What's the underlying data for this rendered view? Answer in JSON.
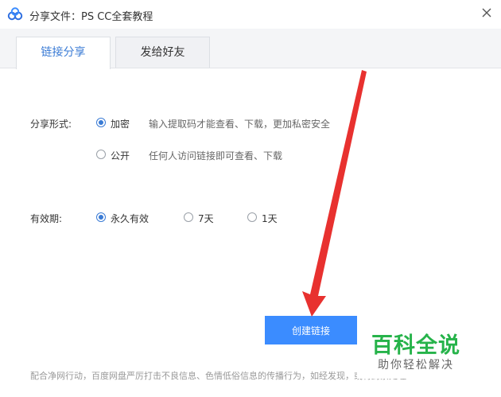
{
  "window": {
    "title": "分享文件：PS CC全套教程",
    "close_icon": "close-icon"
  },
  "tabs": [
    {
      "label": "链接分享",
      "active": true
    },
    {
      "label": "发给好友",
      "active": false
    }
  ],
  "share_form": {
    "label": "分享形式:",
    "options": [
      {
        "label": "加密",
        "desc": "输入提取码才能查看、下载，更加私密安全",
        "checked": true
      },
      {
        "label": "公开",
        "desc": "任何人访问链接即可查看、下载",
        "checked": false
      }
    ]
  },
  "validity": {
    "label": "有效期:",
    "options": [
      {
        "label": "永久有效",
        "checked": true
      },
      {
        "label": "7天",
        "checked": false
      },
      {
        "label": "1天",
        "checked": false
      }
    ]
  },
  "create_button": "创建链接",
  "footer_note": "配合净网行动，百度网盘严厉打击不良信息、色情低俗信息的传播行为，如经发现，或将封禁处理",
  "watermark": {
    "main": "百科全说",
    "sub": "助你轻松解决"
  },
  "colors": {
    "accent": "#3b8cff",
    "tab_active_text": "#3a7bd5",
    "arrow": "#e8312f",
    "watermark_green": "#26b34a"
  }
}
